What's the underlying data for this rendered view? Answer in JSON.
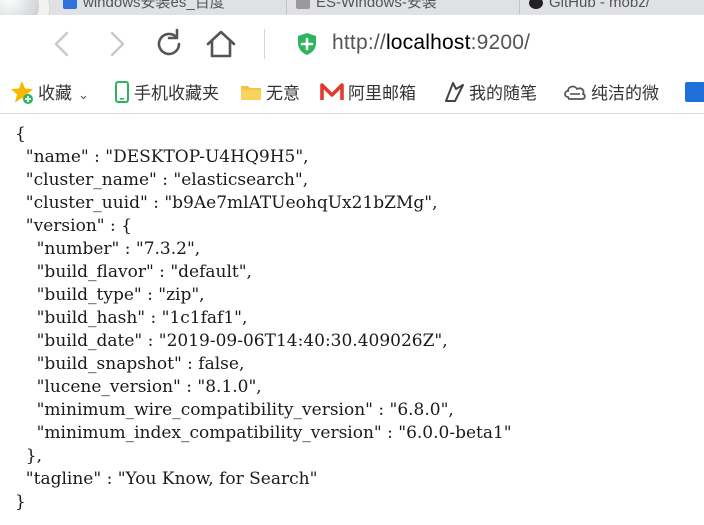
{
  "tabs": [
    {
      "label": "windows安装es_百度",
      "icon_color": "#2f6fe0",
      "icon": "baidu-icon"
    },
    {
      "label": "ES-Windows-安装",
      "icon_color": "#888888",
      "icon": "page-icon"
    },
    {
      "label": "GitHub - mobz/",
      "icon_color": "#222222",
      "icon": "github-icon"
    }
  ],
  "nav": {
    "url_scheme": "http://",
    "url_host": "localhost",
    "url_port": ":9200/",
    "secure_icon": "shield-icon",
    "shield_color": "#2db55d"
  },
  "bookmarks": [
    {
      "label": "收藏",
      "icon": "star-icon",
      "has_chevron": true
    },
    {
      "label": "手机收藏夹",
      "icon": "mobile-icon"
    },
    {
      "label": "无意",
      "icon": "folder-icon"
    },
    {
      "label": "阿里邮箱",
      "icon": "mail-m-icon"
    },
    {
      "label": "我的随笔",
      "icon": "pen-icon"
    },
    {
      "label": "纯洁的微",
      "icon": "cloud-icon"
    },
    {
      "label": "",
      "icon": "partial-icon"
    }
  ],
  "json_lines": [
    "{",
    "  \"name\" : \"DESKTOP-U4HQ9H5\",",
    "  \"cluster_name\" : \"elasticsearch\",",
    "  \"cluster_uuid\" : \"b9Ae7mlATUeohqUx21bZMg\",",
    "  \"version\" : {",
    "    \"number\" : \"7.3.2\",",
    "    \"build_flavor\" : \"default\",",
    "    \"build_type\" : \"zip\",",
    "    \"build_hash\" : \"1c1faf1\",",
    "    \"build_date\" : \"2019-09-06T14:40:30.409026Z\",",
    "    \"build_snapshot\" : false,",
    "    \"lucene_version\" : \"8.1.0\",",
    "    \"minimum_wire_compatibility_version\" : \"6.8.0\",",
    "    \"minimum_index_compatibility_version\" : \"6.0.0-beta1\"",
    "  },",
    "  \"tagline\" : \"You Know, for Search\"",
    "}"
  ]
}
